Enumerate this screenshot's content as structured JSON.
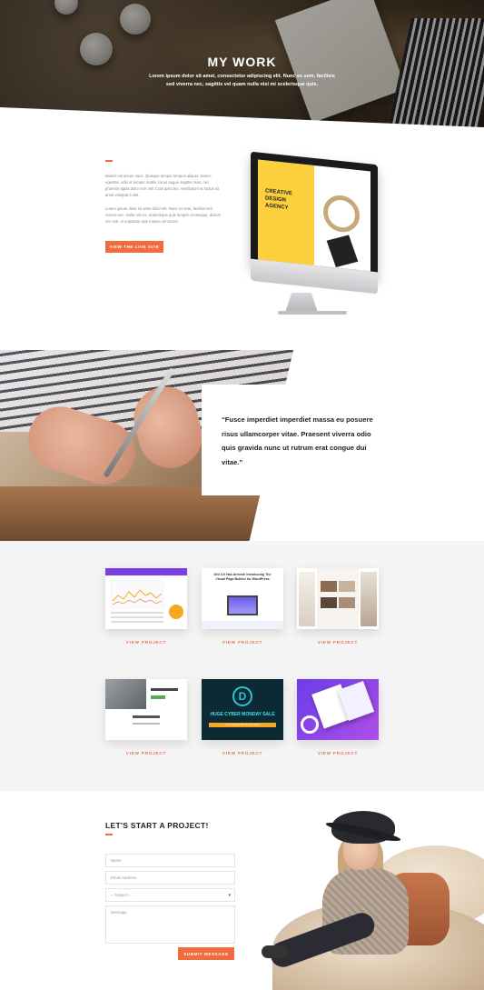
{
  "hero": {
    "title": "MY WORK",
    "subtitle": "Lorem ipsum dolor sit amet, consectetur adipiscing elit. Nunc ex sem, facilisis sed viverra nec, sagittis vel quam nulla nisi mi scelerisque quis."
  },
  "intro": {
    "paragraph1": "Mauris vel ipsum nunc. Quisque tempor tempus aliquet. Donec egestas, odio et tempor mattis, lacus augue sagittis risus, nec pharetra ligula dolor non nisl. Cras justo leo, vestibulum at luctus sit amet volutpat a nisl.",
    "paragraph2": "Lorem ipsum dolor sit amet dolor elit. Nunc ex sem, facilisis sed viverra nec. Nulla nisi mi, scelerisque quis tempor consequat, dictum nec nisl. In vulputate quis massa vel auctor.",
    "button_label": "VIEW THE LIVE SITE",
    "screen_text": "CREATIVE DESIGN AGENCY"
  },
  "quote": {
    "text": "“Fusce imperdiet imperdiet massa eu posuere risus ullamcorper vitae. Praesent viverra odio quis gravida nunc ut rutrum erat congue dui vitae.”"
  },
  "projects": {
    "link_label": "VIEW PROJECT",
    "items": [
      {
        "thumb_title": "",
        "thumb_subtitle": ""
      },
      {
        "thumb_title": "Divi 3.0 Has Arrived! Introducing The Visual Page Builder for WordPress",
        "thumb_subtitle": ""
      },
      {
        "thumb_title": "",
        "thumb_subtitle": ""
      },
      {
        "thumb_title": "",
        "thumb_subtitle": ""
      },
      {
        "thumb_title": "HUGE CYBER MONDAY SALE",
        "thumb_subtitle": "Cyber Monday Membership Plans"
      },
      {
        "thumb_title": "",
        "thumb_subtitle": ""
      }
    ]
  },
  "contact": {
    "title": "LET'S START A PROJECT!",
    "name_placeholder": "Name",
    "email_placeholder": "Email Address",
    "subject_placeholder": "-- Subject --",
    "message_placeholder": "Message",
    "submit_label": "SUBMIT MESSAGE"
  },
  "colors": {
    "accent": "#f06b3e",
    "projects_bg": "#f4f4f4",
    "text_dark": "#222222"
  }
}
